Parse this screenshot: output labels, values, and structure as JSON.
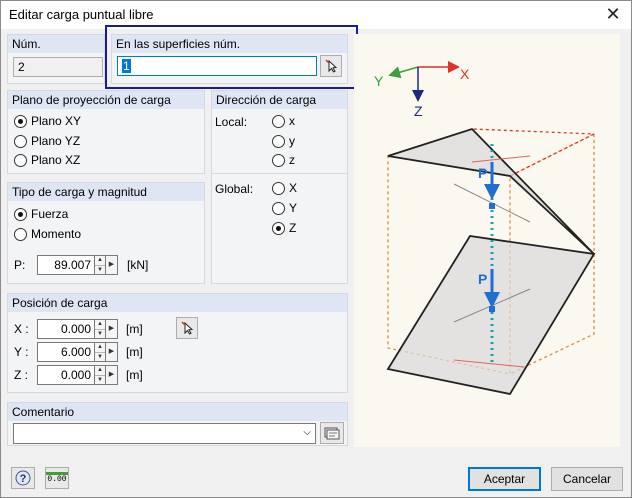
{
  "window": {
    "title": "Editar carga puntual libre"
  },
  "num": {
    "header": "Núm.",
    "value": "2"
  },
  "surfaces": {
    "header": "En las superficies núm.",
    "value": "1"
  },
  "plano": {
    "header": "Plano de proyección de carga",
    "options": [
      "Plano XY",
      "Plano YZ",
      "Plano XZ"
    ],
    "selected": "Plano XY"
  },
  "direccion": {
    "header": "Dirección de carga",
    "local_label": "Local:",
    "local_options": [
      "x",
      "y",
      "z"
    ],
    "global_label": "Global:",
    "global_options": [
      "X",
      "Y",
      "Z"
    ],
    "selected": "Z"
  },
  "tipo": {
    "header": "Tipo de carga y magnitud",
    "options": [
      "Fuerza",
      "Momento"
    ],
    "selected": "Fuerza",
    "p_label": "P:",
    "p_value": "89.007",
    "p_unit": "[kN]"
  },
  "posicion": {
    "header": "Posición de carga",
    "rows": [
      {
        "label": "X :",
        "value": "0.000",
        "unit": "[m]"
      },
      {
        "label": "Y :",
        "value": "6.000",
        "unit": "[m]"
      },
      {
        "label": "Z :",
        "value": "0.000",
        "unit": "[m]"
      }
    ]
  },
  "comentario": {
    "header": "Comentario",
    "value": ""
  },
  "preview": {
    "axis_x": "X",
    "axis_y": "Y",
    "axis_z": "Z",
    "load_label": "P"
  },
  "footer": {
    "accept": "Aceptar",
    "cancel": "Cancelar",
    "units_icon_text": "0.00"
  },
  "colors": {
    "accent_blue": "#1a1a9a",
    "load_blue": "#1f6fd1",
    "axis_red": "#e0302a",
    "axis_green": "#3aa03a",
    "axis_navy": "#1f2a7a",
    "orange_dash": "#e08a3a"
  }
}
